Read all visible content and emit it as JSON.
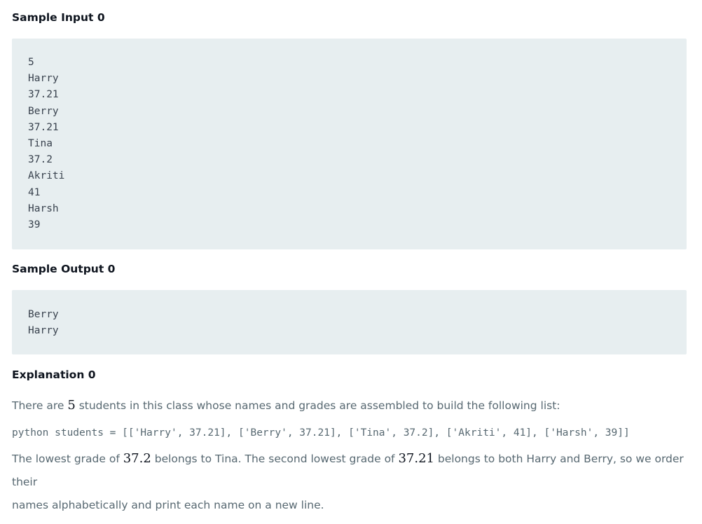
{
  "sample_input": {
    "heading": "Sample Input 0",
    "lines": [
      "5",
      "Harry",
      "37.21",
      "Berry",
      "37.21",
      "Tina",
      "37.2",
      "Akriti",
      "41",
      "Harsh",
      "39"
    ]
  },
  "sample_output": {
    "heading": "Sample Output 0",
    "lines": [
      "Berry",
      "Harry"
    ]
  },
  "explanation": {
    "heading": "Explanation 0",
    "p1_pre": "There are ",
    "p1_num": "5",
    "p1_post": " students in this class whose names and grades are assembled to build the following list:",
    "code": "python students = [['Harry', 37.21], ['Berry', 37.21], ['Tina', 37.2], ['Akriti', 41], ['Harsh', 39]]",
    "p2_a": "The lowest grade of ",
    "p2_num1": "37.2",
    "p2_b": " belongs to Tina. The second lowest grade of ",
    "p2_num2": "37.21",
    "p2_c": " belongs to both Harry and Berry, so we order their",
    "p2_line2": "names alphabetically and print each name on a new line."
  },
  "colors": {
    "heading": "#0e141e",
    "code_bg": "#e7eef0",
    "code_text": "#39424e",
    "body_text": "#576871"
  }
}
